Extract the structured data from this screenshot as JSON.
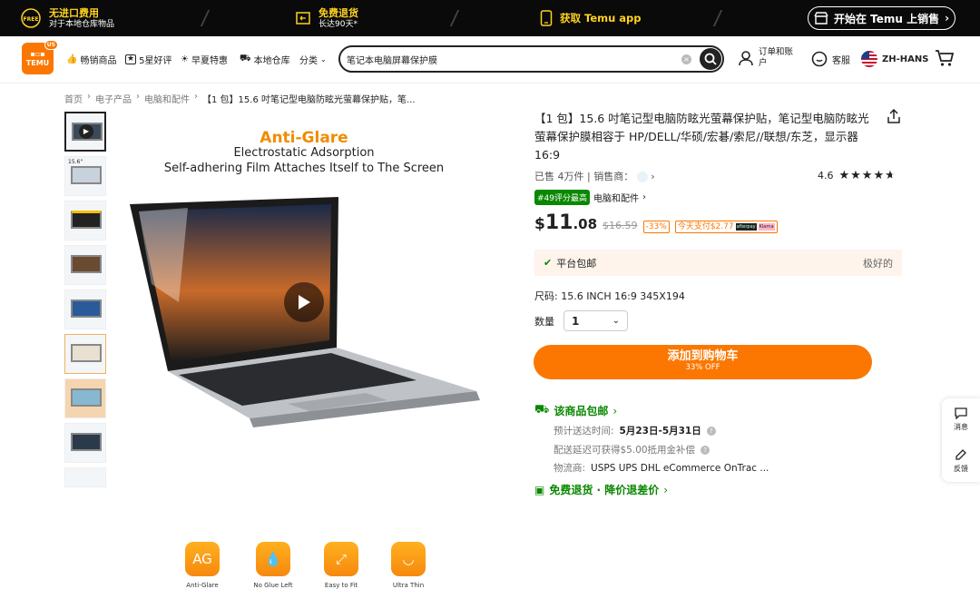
{
  "topbar": {
    "promo1_title": "无进口费用",
    "promo1_sub": "对于本地仓库物品",
    "promo2_title": "免费退货",
    "promo2_sub": "长达90天*",
    "promo3_title": "获取 Temu app",
    "sell_label": "开始在 Temu 上销售",
    "free_badge": "FREE"
  },
  "nav": {
    "logo_text": "TEMU",
    "logo_badge": "US",
    "items": [
      "畅销商品",
      "5星好评",
      "早夏特惠",
      "本地仓库",
      "分类"
    ],
    "search_value": "笔记本电脑屏幕保护膜",
    "orders": "订单和账户",
    "support": "客服",
    "language": "ZH-HANS"
  },
  "breadcrumb": [
    "首页",
    "电子产品",
    "电脑和配件",
    "【1 包】15.6 吋笔记型电脑防眩光萤幕保护贴，笔..."
  ],
  "image": {
    "headline": "Anti-Glare",
    "line1": "Electrostatic Adsorption",
    "line2": "Self-adhering Film Attaches Itself to The Screen",
    "thumb2_label": "15.6\"",
    "features": [
      {
        "icon": "AG",
        "label": "Anti-Glare"
      },
      {
        "icon": "drop",
        "label": "No Glue Left"
      },
      {
        "icon": "expand",
        "label": "Easy to Fit"
      },
      {
        "icon": "curve",
        "label": "Ultra Thin"
      }
    ]
  },
  "product": {
    "title": "【1 包】15.6 吋笔记型电脑防眩光萤幕保护贴，笔记型电脑防眩光萤幕保护膜相容于 HP/DELL/华硕/宏碁/索尼//联想/东芝，显示器 16:9",
    "sold": "已售 4万件",
    "seller_label": "销售商：",
    "rating": "4.6",
    "stars": 4.6,
    "rank_tag": "#49评分最高",
    "rank_cat": "电脑和配件",
    "currency": "$",
    "price_int": "11",
    "price_dec": ".08",
    "price_old": "$16.59",
    "discount": "-33%",
    "today_pay": "今天支付$2.77",
    "pay_badge1": "afterpay",
    "pay_badge2": "Klarna",
    "ship_label": "平台包邮",
    "ship_note": "极好的",
    "size": "尺码: 15.6 INCH 16:9 345X194",
    "qty_label": "数量",
    "qty_value": "1",
    "add_label": "添加到购物车",
    "add_sub": "33% OFF",
    "free_ship": "该商品包邮",
    "eta_label": "预计送达时间:",
    "eta_value": "5月23日-5月31日",
    "late_comp": "配送延迟可获得$5.00抵用金补偿",
    "carrier_label": "物流商:",
    "carriers": "USPS  UPS  DHL eCommerce  OnTrac ...",
    "returns": "免费退货 · 降价退差价"
  },
  "side": {
    "msg": "消息",
    "feedback": "反馈"
  },
  "colors": {
    "accent": "#fb7701",
    "green": "#0a8800",
    "dark": "#0a0a0a"
  }
}
